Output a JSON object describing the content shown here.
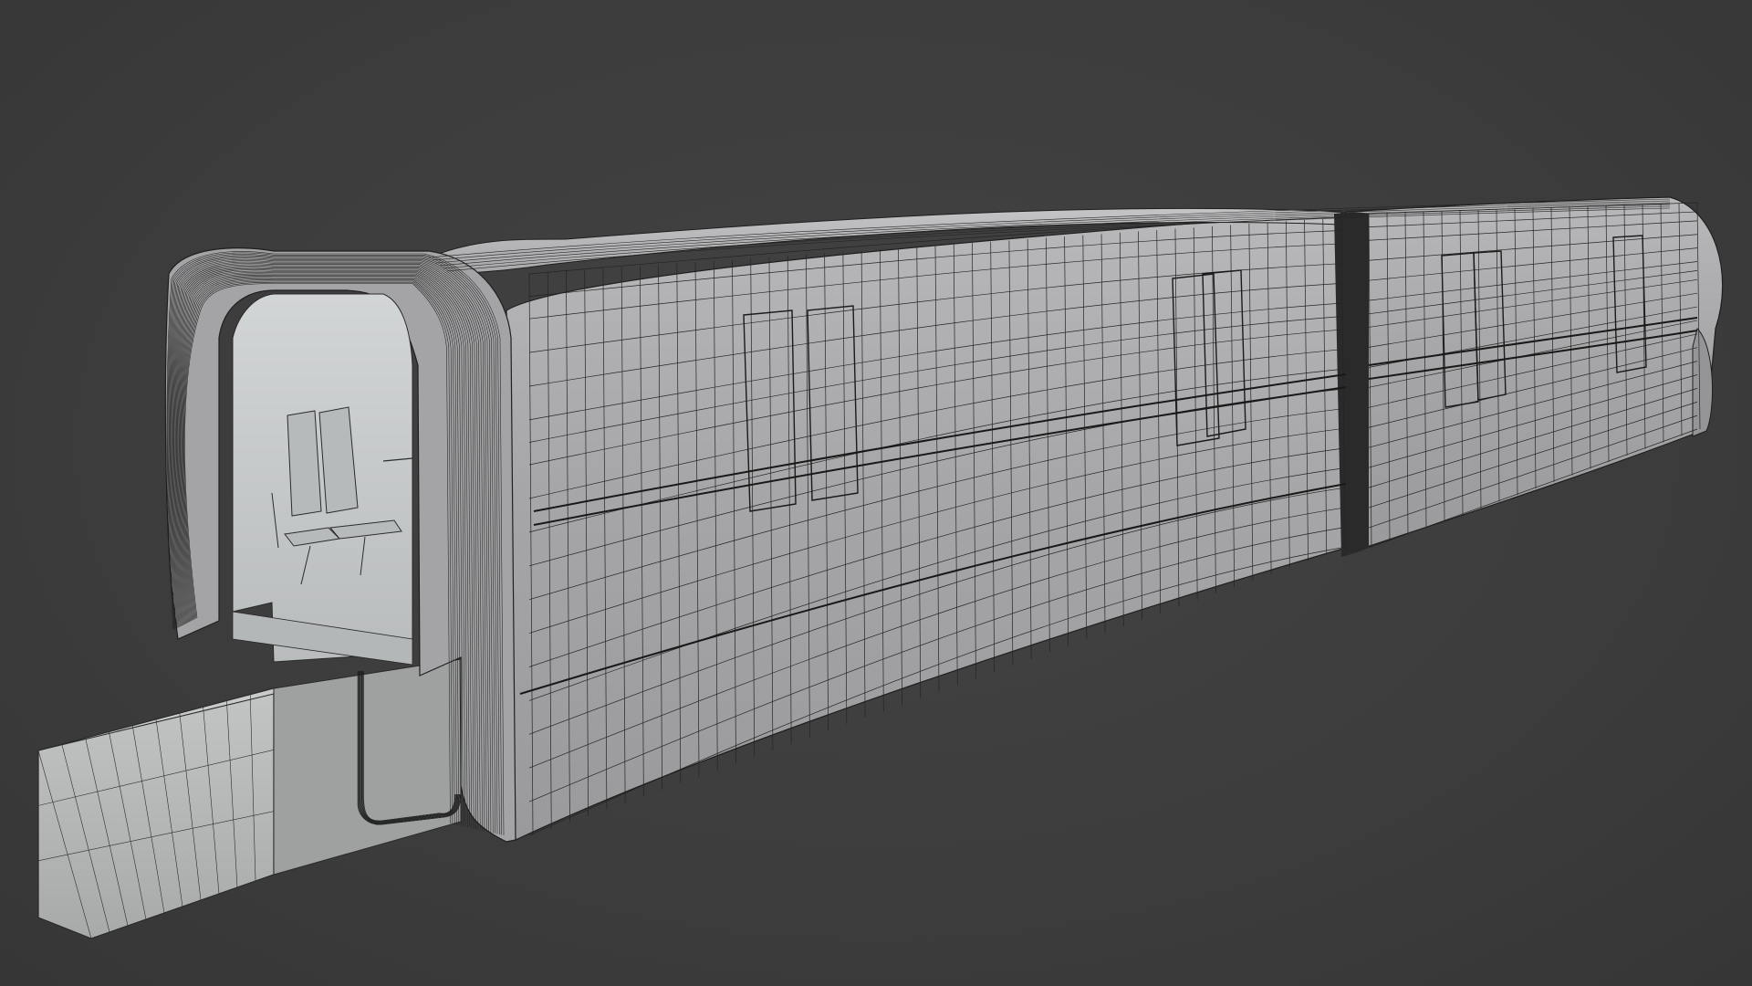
{
  "viewport": {
    "background_color": "#3c3c3c",
    "mode": "wireframe-on-shaded"
  },
  "model": {
    "subject": "monorail-train-with-beam",
    "cars": 2,
    "shade_color": "#a9a9ab",
    "shade_light_color": "#bfc0c2",
    "shade_dark_color": "#8d8d90",
    "wire_color": "#1e1e1e",
    "beam_color": "#b2b4b4",
    "interior_color": "#c6c9ca"
  }
}
